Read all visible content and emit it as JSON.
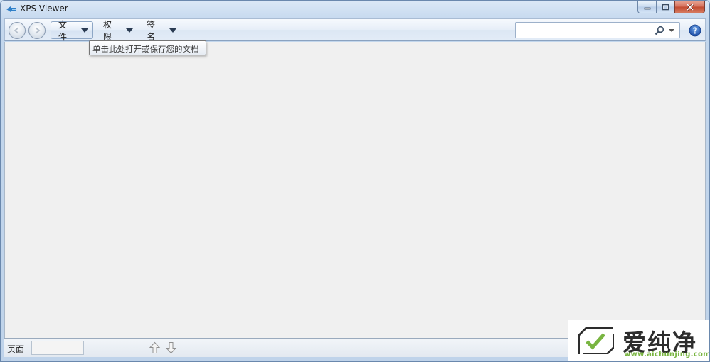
{
  "window": {
    "title": "XPS Viewer"
  },
  "toolbar": {
    "menus": [
      {
        "label": "文件"
      },
      {
        "label": "权限"
      },
      {
        "label": "签名"
      }
    ],
    "search": {
      "value": "",
      "placeholder": ""
    }
  },
  "tooltip": {
    "text": "单击此处打开或保存您的文档"
  },
  "statusbar": {
    "page_label": "页面",
    "page_value": ""
  },
  "watermark": {
    "brand": "爱纯净",
    "url": "www.aichunjing.com"
  },
  "colors": {
    "content_bg": "#f0f0f0",
    "watermark_green": "#79b541"
  },
  "icons": {
    "app": "xps-app-icon",
    "back": "arrow-left-icon",
    "forward": "arrow-right-icon",
    "search": "search-icon",
    "help": "help-icon",
    "page_up": "arrow-up-icon",
    "page_down": "arrow-down-icon"
  }
}
